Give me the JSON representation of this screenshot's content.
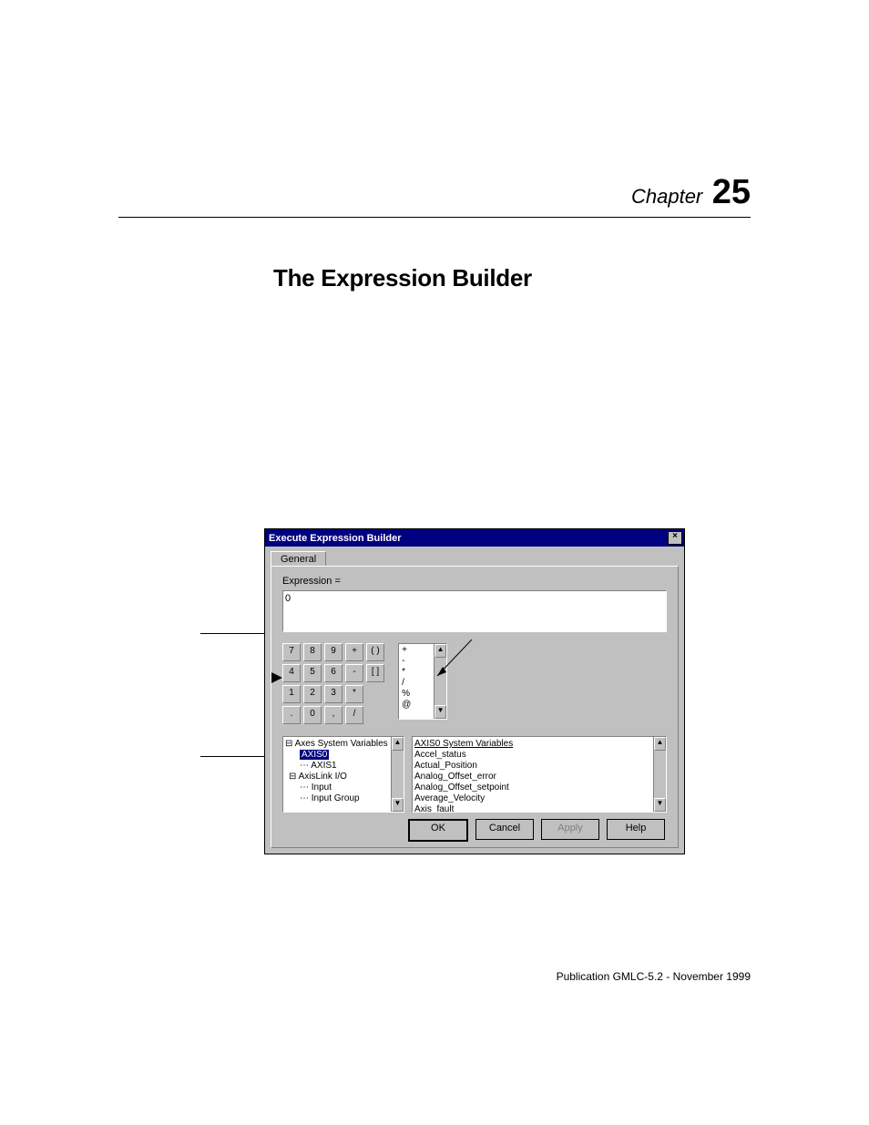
{
  "chapter": {
    "label": "Chapter",
    "number": "25"
  },
  "section_title": "The Expression Builder",
  "footer": "Publication GMLC-5.2 - November 1999",
  "dialog": {
    "title": "Execute Expression Builder",
    "close_glyph": "×",
    "tab": "General",
    "expr_label": "Expression =",
    "expr_value": "0",
    "keypad": {
      "r1": [
        "7",
        "8",
        "9",
        "+",
        "( )"
      ],
      "r2": [
        "4",
        "5",
        "6",
        "-",
        "[ ]"
      ],
      "r3": [
        "1",
        "2",
        "3",
        "*"
      ],
      "r4": [
        ".",
        "0",
        ",",
        "/"
      ]
    },
    "operators": [
      "+",
      "-",
      "*",
      "/",
      "%",
      "@"
    ],
    "tree": {
      "root": "Axes System Variables",
      "sel": "AXIS0",
      "items": [
        "AXIS1",
        "AxisLink I/O",
        "Input",
        "Input Group"
      ]
    },
    "varlist_header": "AXIS0 System Variables",
    "varlist": [
      "Accel_status",
      "Actual_Position",
      "Analog_Offset_error",
      "Analog_Offset_setpoint",
      "Average_Velocity",
      "Axis_fault"
    ],
    "buttons": {
      "ok": "OK",
      "cancel": "Cancel",
      "apply": "Apply",
      "help": "Help"
    }
  }
}
